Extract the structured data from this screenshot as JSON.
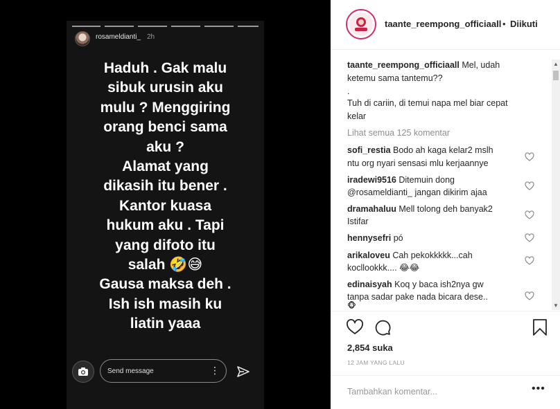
{
  "story": {
    "username": "rosameldianti_",
    "time": "2h",
    "lines": [
      "Haduh . Gak malu",
      "sibuk urusin aku",
      "mulu ? Menggiring",
      "orang benci sama",
      "aku ?",
      "Alamat yang",
      "dikasih itu bener .",
      "Kantor kuasa",
      "hukum aku . Tapi",
      "yang difoto itu",
      "salah 🤣😅",
      "Gausa maksa deh .",
      "Ish ish masih ku",
      "liatin yaaa"
    ],
    "send_placeholder": "Send message",
    "more_glyph": "⋮",
    "icons": [
      "camera-icon",
      "send-icon",
      "more-vertical-icon"
    ]
  },
  "post": {
    "owner": "taante_reempong_officiaall",
    "dot": "•",
    "follow_label": "Diikuti",
    "caption": {
      "user": "taante_reempong_officiaall",
      "lines": [
        "Mel, udah",
        "ketemu sama tantemu??",
        ".",
        "Tuh di cariin, di temui napa mel biar cepat",
        "kelar"
      ]
    },
    "view_all": "Lihat semua 125 komentar",
    "comments": [
      {
        "user": "sofi_restia",
        "text": [
          "Bodo ah kaga kelar2 mslh",
          "ntu org nyari sensasi mlu kerjaannye"
        ]
      },
      {
        "user": "iradewi9516",
        "text": [
          "Ditemuin dong",
          "@rosameldianti_ jangan dikirim ajaa"
        ]
      },
      {
        "user": "dramahaluu",
        "text": [
          "Mell tolong deh banyak2",
          "Istifar"
        ]
      },
      {
        "user": "hennysefri",
        "text": [
          "pó"
        ]
      },
      {
        "user": "arikaloveu",
        "text": [
          "Cah pekokkkkk...cah",
          "kocllookkk.... 😂😂"
        ]
      },
      {
        "user": "edinaisyah",
        "text": [
          "Koq y baca ish2nya gw",
          "tanpa sadar pake nada bicara dese.."
        ]
      }
    ],
    "emoji_peek": "🐵",
    "likes": "2,854 suka",
    "time_ago": "12 JAM YANG LALU",
    "comment_placeholder": "Tambahkan komentar...",
    "comment_more": "•••",
    "icons": [
      "heart-icon",
      "comment-icon",
      "bookmark-icon"
    ],
    "accent": "#d02d6e"
  }
}
